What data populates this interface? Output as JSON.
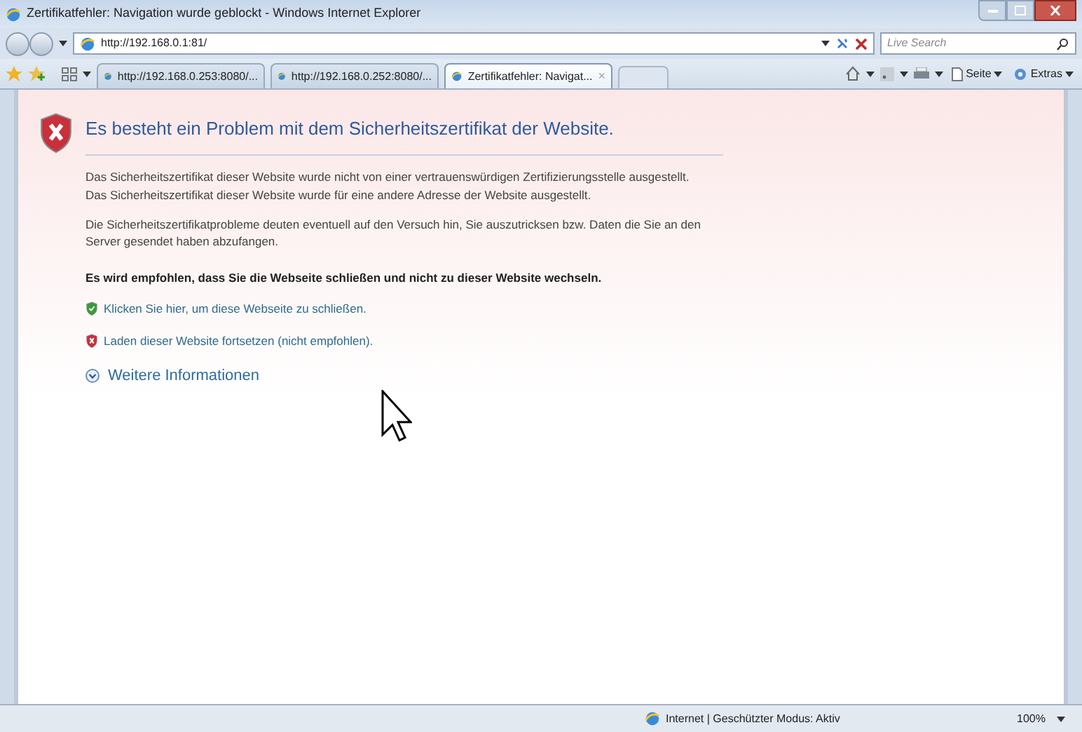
{
  "window": {
    "title": "Zertifikatfehler: Navigation wurde geblockt - Windows Internet Explorer"
  },
  "address_bar": {
    "url": "http://192.168.0.1:81/"
  },
  "search": {
    "placeholder": "Live Search"
  },
  "tabs": [
    {
      "label": "http://192.168.0.253:8080/...",
      "selected": false
    },
    {
      "label": "http://192.168.0.252:8080/...",
      "selected": false
    },
    {
      "label": "Zertifikatfehler: Navigat...",
      "selected": true,
      "close": "×"
    }
  ],
  "command_bar": [
    "Seite",
    "Extras"
  ],
  "page": {
    "heading": "Es besteht ein Problem mit dem Sicherheitszertifikat der Website.",
    "paragraphs": [
      [
        "Das Sicherheitszertifikat dieser Website wurde nicht von einer vertrauenswürdigen Zertifizierungsstelle ausgestellt.",
        "Das Sicherheitszertifikat dieser Website wurde für eine andere Adresse der Website ausgestellt."
      ],
      [
        "Die Sicherheitszertifikatprobleme deuten eventuell auf den Versuch hin, Sie auszutricksen bzw. Daten die Sie an den Server gesendet haben abzufangen."
      ]
    ],
    "recommendation": "Es wird empfohlen, dass Sie die Webseite schließen und nicht zu dieser Website wechseln.",
    "links": [
      {
        "kind": "safe",
        "label": "Klicken Sie hier, um diese Webseite zu schließen."
      },
      {
        "kind": "unsafe",
        "label": "Laden dieser Website fortsetzen (nicht empfohlen)."
      }
    ],
    "more_info": "Weitere Informationen"
  },
  "status_bar": {
    "text": "Internet | Geschützter Modus: Aktiv",
    "zoom": "100%"
  }
}
